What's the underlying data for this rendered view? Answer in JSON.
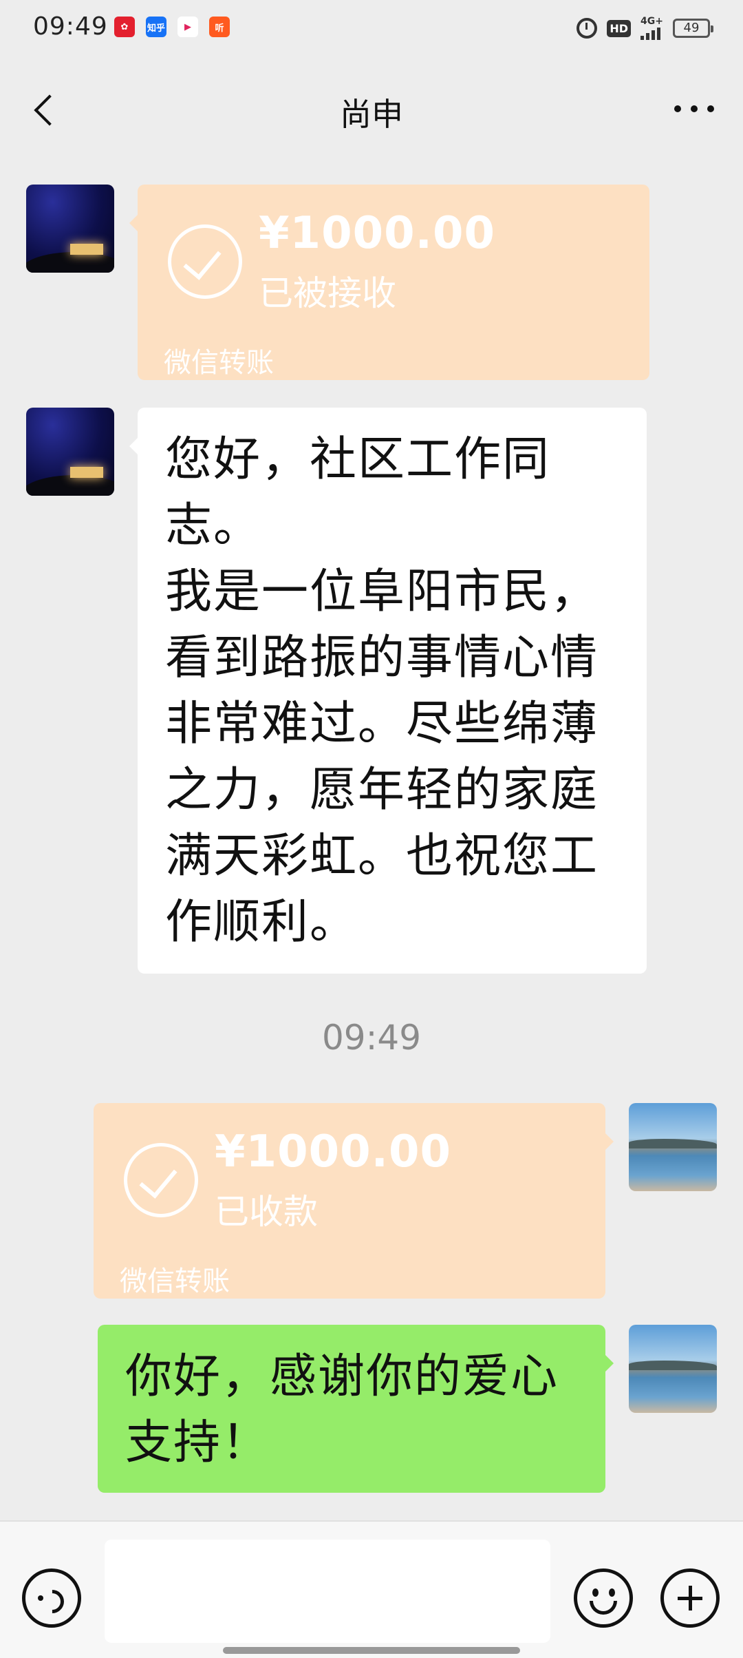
{
  "status_bar": {
    "time": "09:49",
    "app_icons": [
      {
        "name": "red-app-icon",
        "label": "",
        "color": "#e3202e"
      },
      {
        "name": "zhihu-app-icon",
        "label": "知乎",
        "color": "#1772f6"
      },
      {
        "name": "video-app-icon",
        "label": "▶",
        "color": "#ffffff"
      },
      {
        "name": "listen-app-icon",
        "label": "听",
        "color": "#ff5a1f"
      }
    ],
    "hd_label": "HD",
    "network_label": "4G+",
    "battery_level": "49"
  },
  "nav": {
    "title": "尚申",
    "back_icon": "chevron-left-icon",
    "more_icon": "more-dots-icon"
  },
  "messages": {
    "transfer_received": {
      "amount": "¥1000.00",
      "status": "已被接收",
      "brand": "微信转账"
    },
    "donor_text": "您好，社区工作同志。\n我是一位阜阳市民，看到路振的事情心情非常难过。尽些绵薄之力，愿年轻的家庭满天彩虹。也祝您工作顺利。",
    "timestamp": "09:49",
    "transfer_collected": {
      "amount": "¥1000.00",
      "status": "已收款",
      "brand": "微信转账"
    },
    "reply_text": "你好，感谢你的爱心支持！"
  },
  "colors": {
    "transfer_bubble": "#fde0c2",
    "sent_bubble": "#95ec69",
    "received_bubble": "#ffffff",
    "background": "#ededed"
  },
  "input_bar": {
    "voice_icon": "voice-icon",
    "emoji_icon": "emoji-icon",
    "plus_icon": "plus-icon",
    "input_value": ""
  }
}
